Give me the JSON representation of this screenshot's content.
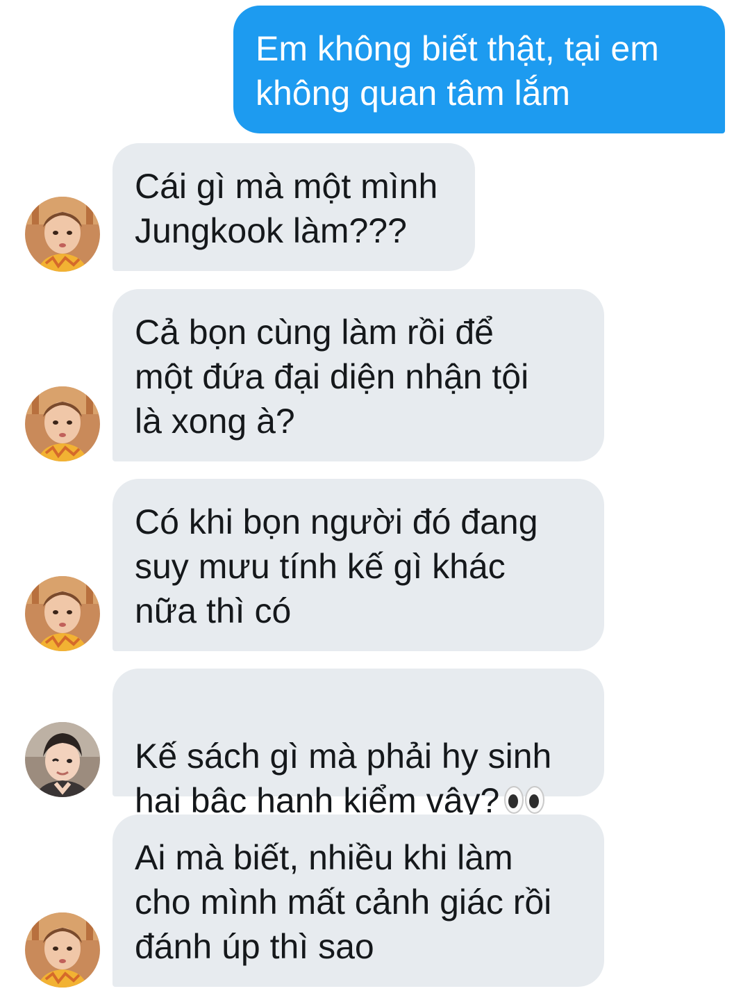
{
  "messages": [
    {
      "from": "me",
      "text": "Em không biết thật, tại em\nkhông quan tâm lắm"
    },
    {
      "from": "them",
      "avatar": "avatar-a",
      "text": "Cái gì mà một mình\nJungkook làm???"
    },
    {
      "from": "them",
      "avatar": "avatar-a",
      "text": "Cả bọn cùng làm rồi để\nmột đứa đại diện nhận tội\nlà xong à?"
    },
    {
      "from": "them",
      "avatar": "avatar-a",
      "text": "Có khi bọn người đó đang\nsuy mưu tính kế gì khác\nnữa thì có"
    },
    {
      "from": "them",
      "avatar": "avatar-b",
      "text": "Kế sách gì mà phải hy sinh\nhai bậc hạnh kiểm vậy?",
      "emoji": "eyes-emoji"
    },
    {
      "from": "them",
      "avatar": "avatar-a",
      "text": "Ai mà biết, nhiều khi làm\ncho mình mất cảnh giác rồi\nđánh úp thì sao"
    }
  ],
  "colors": {
    "outgoing_bubble": "#1d9bf0",
    "incoming_bubble": "#e7ebef",
    "outgoing_text": "#ffffff",
    "incoming_text": "#15181b"
  }
}
